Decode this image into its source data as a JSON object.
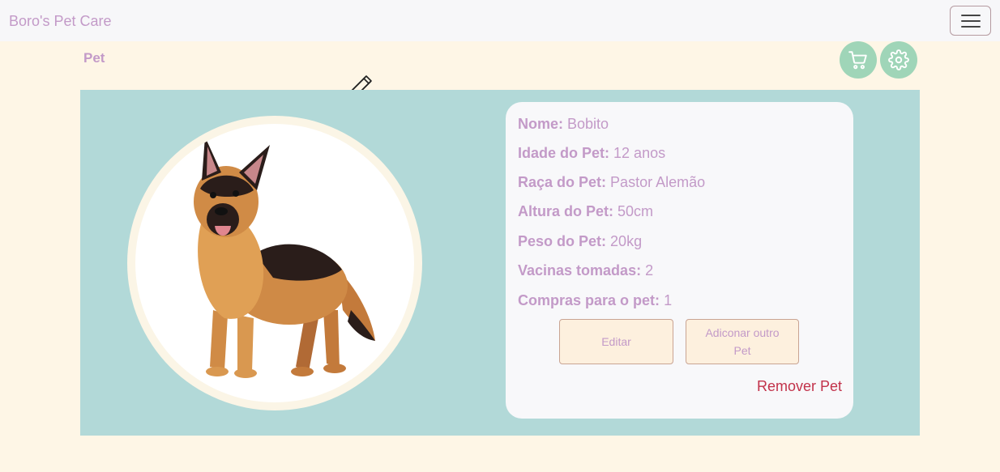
{
  "navbar": {
    "brand": "Boro's Pet Care"
  },
  "page": {
    "title": "Pet"
  },
  "pet": {
    "fields": [
      {
        "label": "Nome:",
        "value": "Bobito"
      },
      {
        "label": "Idade do Pet:",
        "value": "12 anos"
      },
      {
        "label": "Raça do Pet:",
        "value": "Pastor Alemão"
      },
      {
        "label": "Altura do Pet:",
        "value": "50cm"
      },
      {
        "label": "Peso do Pet:",
        "value": "20kg"
      },
      {
        "label": "Vacinas tomadas:",
        "value": "2"
      },
      {
        "label": "Compras para o pet:",
        "value": "1"
      }
    ]
  },
  "actions": {
    "edit_label": "Editar",
    "add_label": "Adiconar outro Pet",
    "remove_label": "Remover Pet"
  },
  "icons": {
    "menu": "hamburger-icon",
    "cart": "cart-icon",
    "settings": "gear-icon",
    "edit": "pencil-icon",
    "pet_photo": "german-shepherd-dog-image"
  },
  "colors": {
    "background": "#fef6e6",
    "card": "#b2d9d8",
    "accent_text": "#c39ac8",
    "round_buttons": "#9fd5b8",
    "remove": "#c2324a"
  }
}
